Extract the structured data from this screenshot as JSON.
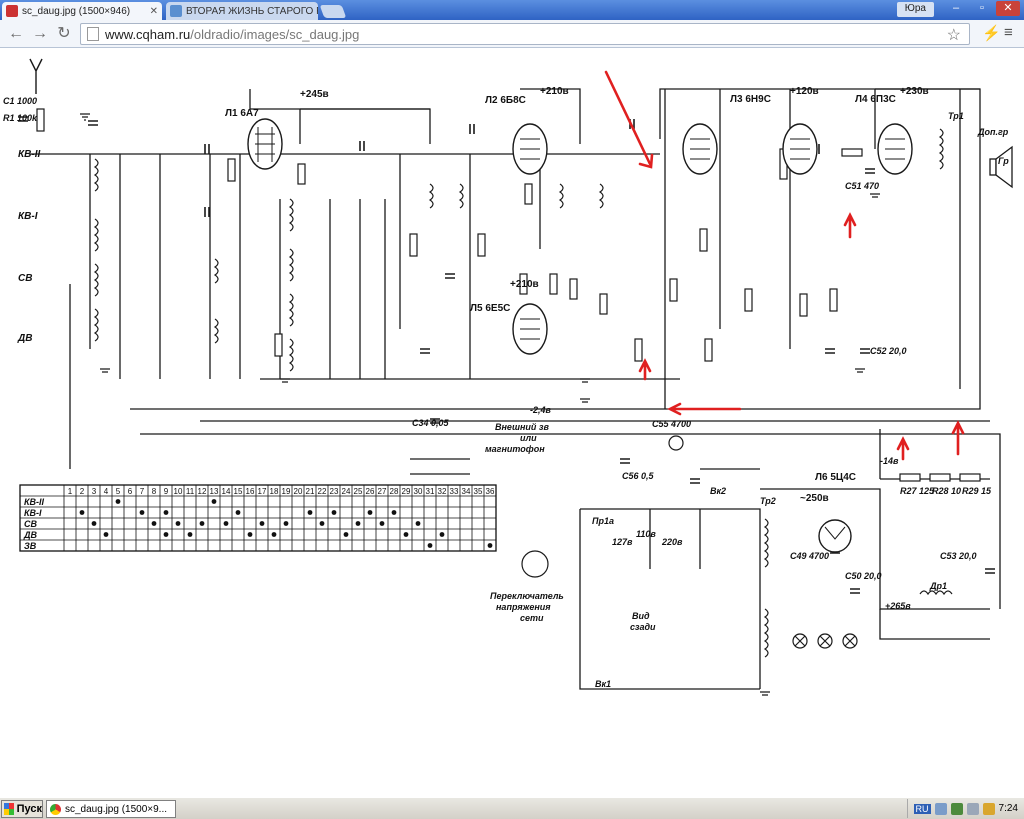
{
  "browser": {
    "tabs": [
      {
        "title": "sc_daug.jpg (1500×946)",
        "active": true
      },
      {
        "title": "ВТОРАЯ ЖИЗНЬ СТАРОГО Р",
        "active": false
      }
    ],
    "user": "Юра",
    "url_host": "www.cqham.ru",
    "url_path": "/oldradio/images/sc_daug.jpg"
  },
  "schematic": {
    "tubes": [
      {
        "label": "Л1 6А7",
        "voltage": "+245в"
      },
      {
        "label": "Л2 6Б8С",
        "voltage": "+210в"
      },
      {
        "label": "Л3 6Н9С",
        "voltage": "+120в"
      },
      {
        "label": "Л4 6П3С",
        "voltage": "+230в"
      },
      {
        "label": "Л5 6Е5С",
        "voltage": "+210в"
      },
      {
        "label": "Л6 5Ц4С",
        "voltage": "~250в"
      }
    ],
    "bands": [
      "КВ-II",
      "КВ-I",
      "СВ",
      "ДВ",
      "ЗВ"
    ],
    "switch_numbers": [
      "1",
      "2",
      "3",
      "4",
      "5",
      "6",
      "7",
      "8",
      "9",
      "10",
      "11",
      "12",
      "13",
      "14",
      "15",
      "16",
      "17",
      "18",
      "19",
      "20",
      "21",
      "22",
      "23",
      "24",
      "25",
      "26",
      "27",
      "28",
      "29",
      "30",
      "31",
      "32",
      "33",
      "34",
      "35",
      "36"
    ],
    "switch_matrix": [
      [
        0,
        0,
        0,
        0,
        1,
        0,
        0,
        0,
        0,
        0,
        0,
        0,
        1,
        0,
        0,
        0,
        0,
        0,
        0,
        0,
        0,
        0,
        0,
        0,
        0,
        0,
        0,
        0,
        0,
        0,
        0,
        0,
        0,
        0,
        0,
        0
      ],
      [
        0,
        1,
        0,
        0,
        0,
        0,
        1,
        0,
        1,
        0,
        0,
        0,
        0,
        0,
        1,
        0,
        0,
        0,
        0,
        0,
        1,
        0,
        1,
        0,
        0,
        1,
        0,
        1,
        0,
        0,
        0,
        0,
        0,
        0,
        0,
        0
      ],
      [
        0,
        0,
        1,
        0,
        0,
        0,
        0,
        1,
        0,
        1,
        0,
        1,
        0,
        1,
        0,
        0,
        1,
        0,
        1,
        0,
        0,
        1,
        0,
        0,
        1,
        0,
        1,
        0,
        0,
        1,
        0,
        0,
        0,
        0,
        0,
        0
      ],
      [
        0,
        0,
        0,
        1,
        0,
        0,
        0,
        0,
        1,
        0,
        1,
        0,
        0,
        0,
        0,
        1,
        0,
        1,
        0,
        0,
        0,
        0,
        0,
        1,
        0,
        0,
        0,
        0,
        1,
        0,
        0,
        1,
        0,
        0,
        0,
        0
      ],
      [
        0,
        0,
        0,
        0,
        0,
        0,
        0,
        0,
        0,
        0,
        0,
        0,
        0,
        0,
        0,
        0,
        0,
        0,
        0,
        0,
        0,
        0,
        0,
        0,
        0,
        0,
        0,
        0,
        0,
        0,
        1,
        0,
        0,
        0,
        0,
        1
      ]
    ],
    "labels": {
      "external": "Внешний зв",
      "or": "или",
      "recorder": "магнитофон",
      "voltage_switch_1": "Переключатель",
      "voltage_switch_2": "напряжения",
      "voltage_switch_3": "сети",
      "rear_view_1": "Вид",
      "rear_view_2": "сзади",
      "fuse": "Пр1а",
      "switch_vk1": "Вк1",
      "switch_vk2": "Вк2",
      "transformer_tp1": "Тр1",
      "transformer_tp2": "Тр2",
      "choke": "Др1",
      "speaker": "Гр",
      "addgr": "Доп.гр",
      "v127": "127в",
      "v110": "110в",
      "v220": "220в",
      "plus265": "+265в",
      "minus24": "-2,4в",
      "minus14": "-14в",
      "r1": "R1 100k",
      "c1": "C1 1000",
      "r77": "R27 125",
      "r28": "R28 10",
      "r29": "R29 15",
      "c53": "C53 20,0",
      "c56": "C56 0,5",
      "c55": "C55 4700",
      "c51": "C51 470",
      "c52": "C52 20,0",
      "c50": "C50 20,0",
      "c49": "C49 4700",
      "c34": "C34 0,05"
    },
    "arrow_color": "#e02020"
  },
  "taskbar": {
    "start": "Пуск",
    "item": "sc_daug.jpg (1500×9...",
    "lang": "RU",
    "time": "7:24"
  }
}
